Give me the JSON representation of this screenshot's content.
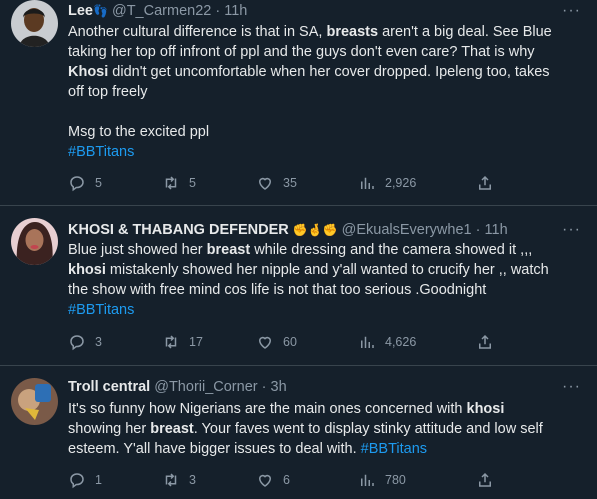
{
  "tweets": [
    {
      "name": "Lee",
      "name_suffix": "👣",
      "handle": "@T_Carmen22",
      "time": "11h",
      "lines": [
        "Another cultural difference is that in SA, breasts aren't a big deal. See Blue",
        "taking her top off infront of ppl and the guys don't even care? That is why",
        "Khosi didn't get uncomfortable when her cover dropped. Ipeleng too, takes",
        "off top freely",
        "",
        "Msg to the excited ppl",
        "#BBTitans"
      ],
      "replies": "5",
      "retweets": "5",
      "likes": "35",
      "views": "2,926"
    },
    {
      "name": "KHOSI & THABANG DEFENDER",
      "name_suffix": "✊🤞✊",
      "handle": "@EkualsEverywhe1",
      "time": "11h",
      "lines": [
        "Blue just showed her breast while dressing and the camera showed it ,,,",
        "khosi mistakenly showed her nipple and y'all wanted to crucify her ,, watch",
        "the show with free mind cos life is not that too serious .Goodnight",
        "#BBTitans"
      ],
      "replies": "3",
      "retweets": "17",
      "likes": "60",
      "views": "4,626"
    },
    {
      "name": "Troll central",
      "name_suffix": "",
      "handle": "@Thorii_Corner",
      "time": "3h",
      "lines": [
        "It's so funny how Nigerians are the main ones concerned with khosi",
        "showing her breast. Your faves went to display stinky attitude and low self",
        "esteem. Y'all have bigger issues to deal with. #BBTitans"
      ],
      "replies": "1",
      "retweets": "3",
      "likes": "6",
      "views": "780"
    }
  ],
  "ui": {
    "more": "···",
    "dot": "·"
  },
  "colors": {
    "background": "#15202b",
    "text": "#e7e9ea",
    "muted": "#8b98a5",
    "link": "#1d9bf0",
    "divider": "#38444d"
  },
  "icons": [
    "reply-icon",
    "retweet-icon",
    "like-icon",
    "views-icon",
    "share-icon"
  ]
}
